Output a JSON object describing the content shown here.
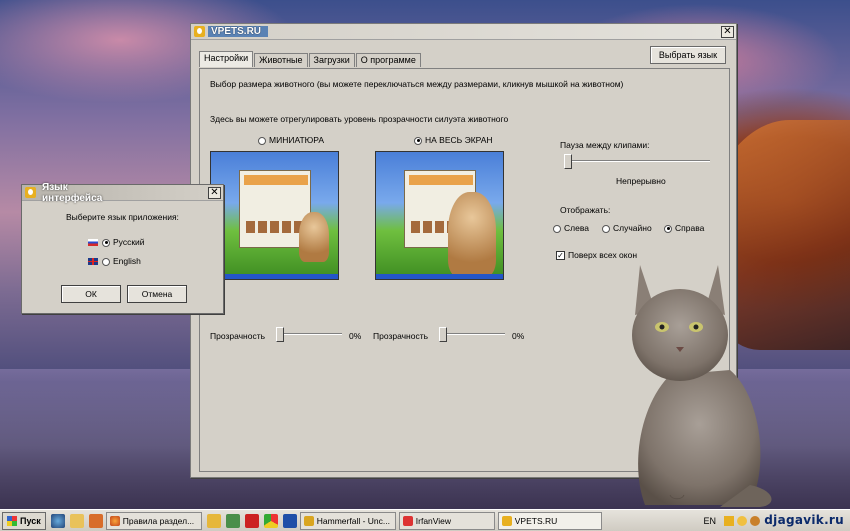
{
  "colors": {
    "window_bg": "#d4d0c8",
    "taskbar": "#d4d0c8",
    "title_highlight": "#5a82b4"
  },
  "main_window": {
    "title": "VPETS.RU",
    "close_icon": "close-icon",
    "tabs": [
      "Настройки",
      "Животные",
      "Загрузки",
      "О программе"
    ],
    "active_tab": "Настройки",
    "choose_language_button": "Выбрать язык",
    "size_hint": "Выбор размера животного (вы можете переключаться между размерами, кликнув мышкой на животном)",
    "transparency_hint": "Здесь вы можете отрегулировать уровень прозрачности силуэта животного",
    "size_options": {
      "miniature": "МИНИАТЮРА",
      "fullscreen": "НА ВЕСЬ ЭКРАН",
      "selected": "fullscreen"
    },
    "transparency": {
      "label": "Прозрачность",
      "miniature_value": "0%",
      "fullscreen_value": "0%",
      "miniature_level": 0,
      "fullscreen_level": 0
    },
    "pause": {
      "label": "Пауза между клипами:",
      "value_text": "Непрерывно",
      "level": 0
    },
    "display": {
      "label": "Отображать:",
      "options": [
        "Слева",
        "Случайно",
        "Справа"
      ],
      "selected": "Справа"
    },
    "always_on_top": {
      "label": "Поверх всех окон",
      "checked": true
    }
  },
  "language_dialog": {
    "title": "Язык интерфейса",
    "prompt": "Выберите язык приложения:",
    "options": [
      {
        "label": "Русский",
        "flag": "flag-ru",
        "selected": true
      },
      {
        "label": "English",
        "flag": "flag-uk",
        "selected": false
      }
    ],
    "ok_button": "ОК",
    "cancel_button": "Отмена"
  },
  "taskbar": {
    "start_label": "Пуск",
    "quick_launch": [
      "ie-icon",
      "folder-icon",
      "media-icon"
    ],
    "buttons": [
      {
        "label": "Правила раздел...",
        "icon": "firefox-icon"
      },
      {
        "label": "Hammerfall - Unc...",
        "icon": "winamp-icon"
      },
      {
        "label": "IrfanView",
        "icon": "irfanview-icon"
      },
      {
        "label": "VPETS.RU",
        "icon": "vpets-icon"
      }
    ],
    "language_indicator": "EN",
    "watermark": "djagavik.ru"
  }
}
